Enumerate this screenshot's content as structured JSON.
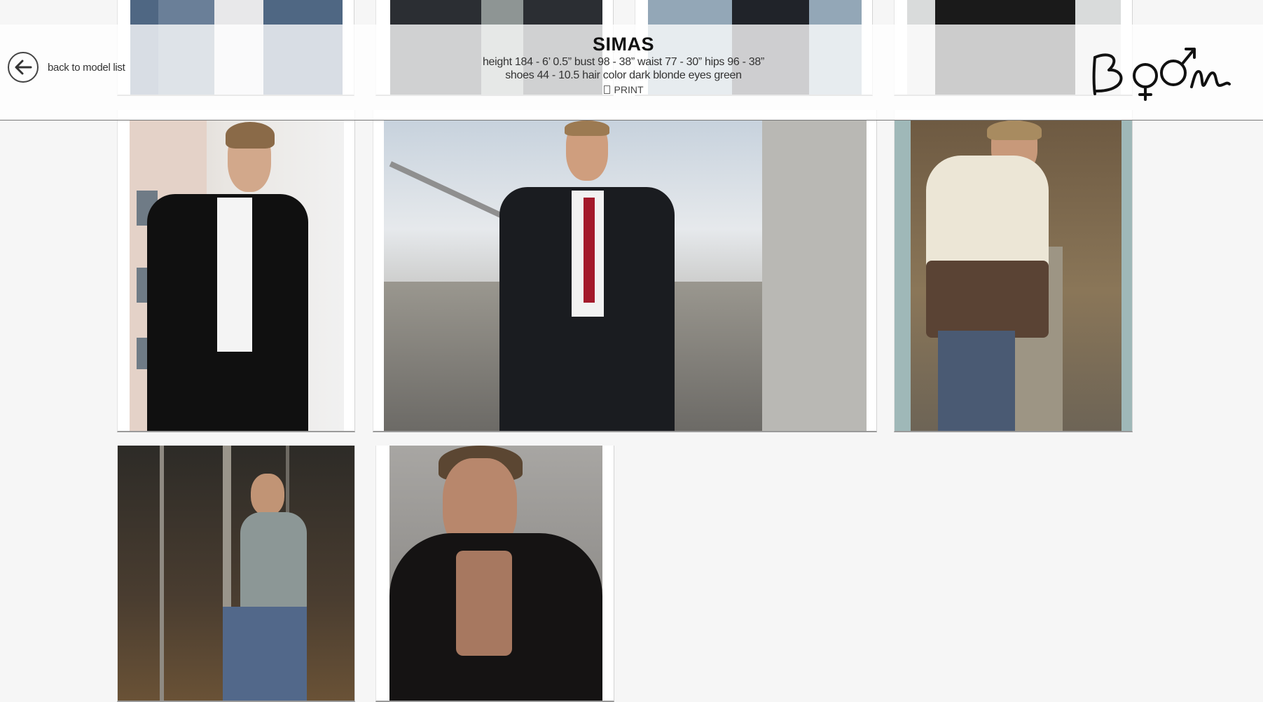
{
  "nav": {
    "back_label": "back to model list",
    "back_icon": "arrow-left-circle-icon"
  },
  "model": {
    "name": "SIMAS",
    "measurements_line1": "height 184 - 6’ 0.5”  bust 98 - 38”  waist 77 - 30”  hips 96 - 38”",
    "measurements_line2": "shoes 44 - 10.5  hair color dark blonde  eyes green"
  },
  "actions": {
    "print_label": "PRINT",
    "print_icon": "document-icon"
  },
  "brand": {
    "logo_text": "Boom",
    "logo_icon": "gender-symbols-logo"
  },
  "gallery": {
    "photos": [
      {
        "alt": "denim-jacket-photo"
      },
      {
        "alt": "grey-jacket-photo"
      },
      {
        "alt": "dark-jacket-photo"
      },
      {
        "alt": "leather-jacket-photo"
      },
      {
        "alt": "black-blazer-portrait"
      },
      {
        "alt": "suit-red-tie-staircase"
      },
      {
        "alt": "fleece-hoodie-boardwalk"
      },
      {
        "alt": "grey-blazer-forest"
      },
      {
        "alt": "black-shirt-portrait"
      }
    ]
  },
  "colors": {
    "background": "#f6f6f6",
    "header_overlay": "rgba(255,255,255,0.78)",
    "text": "#222222"
  }
}
